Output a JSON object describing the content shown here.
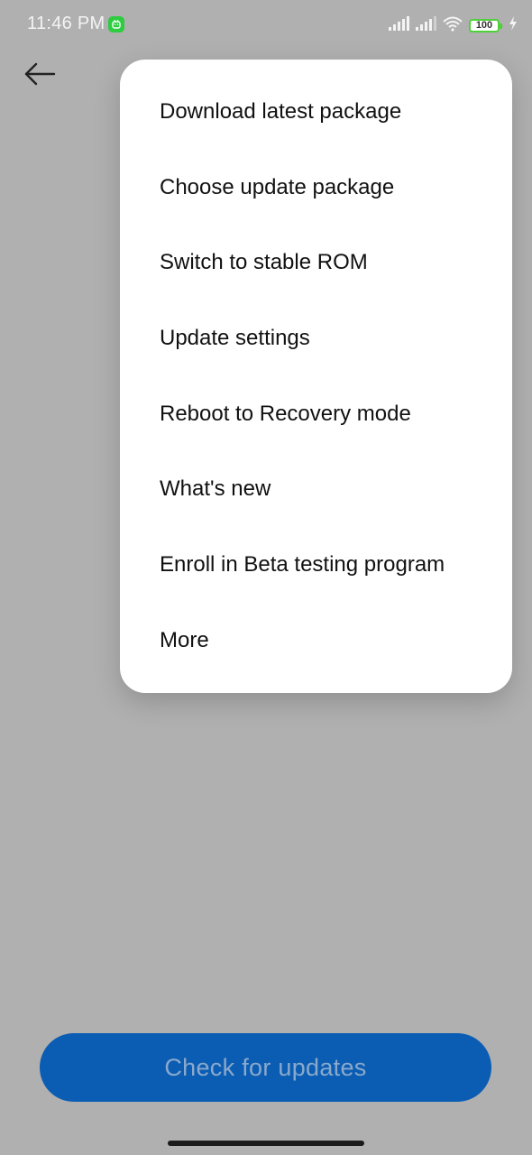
{
  "status_bar": {
    "time": "11:46 PM",
    "battery_level": "100",
    "icons": [
      "app-notification-icon",
      "signal-icon",
      "signal-icon",
      "wifi-icon",
      "battery-icon",
      "charging-icon"
    ]
  },
  "header": {
    "back_icon": "arrow-left-icon"
  },
  "menu": {
    "items": [
      {
        "label": "Download latest package"
      },
      {
        "label": "Choose update package"
      },
      {
        "label": "Switch to stable ROM"
      },
      {
        "label": "Update settings"
      },
      {
        "label": "Reboot to Recovery mode"
      },
      {
        "label": "What's new"
      },
      {
        "label": "Enroll in Beta testing program"
      },
      {
        "label": "More"
      }
    ]
  },
  "primary_action": {
    "label": "Check for updates"
  },
  "colors": {
    "scrim_background": "#b0b0b0",
    "menu_background": "#ffffff",
    "button_background": "#0b5db3",
    "button_text": "#8aa9cc",
    "battery_accent": "#4cd137"
  }
}
